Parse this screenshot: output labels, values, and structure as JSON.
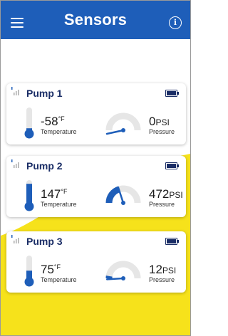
{
  "header": {
    "title": "Sensors"
  },
  "colors": {
    "header_bg": "#1e5eb9",
    "accent_blue": "#1e5eb9",
    "background_yellow": "#f6e21b",
    "gauge_track": "#e6e6e6",
    "text_dark": "#1a2d66"
  },
  "pumps": [
    {
      "name": "Pump 1",
      "temperature": {
        "value": "-58",
        "unit": "°F",
        "label": "Temperature",
        "level": 0.15
      },
      "pressure": {
        "value": "0",
        "unit": "PSI",
        "label": "Pressure",
        "fraction": 0.0
      }
    },
    {
      "name": "Pump 2",
      "temperature": {
        "value": "147",
        "unit": "°F",
        "label": "Temperature",
        "level": 0.9
      },
      "pressure": {
        "value": "472",
        "unit": "PSI",
        "label": "Pressure",
        "fraction": 0.4
      }
    },
    {
      "name": "Pump 3",
      "temperature": {
        "value": "75",
        "unit": "°F",
        "label": "Temperature",
        "level": 0.4
      },
      "pressure": {
        "value": "12",
        "unit": "PSI",
        "label": "Pressure",
        "fraction": 0.05
      }
    }
  ]
}
